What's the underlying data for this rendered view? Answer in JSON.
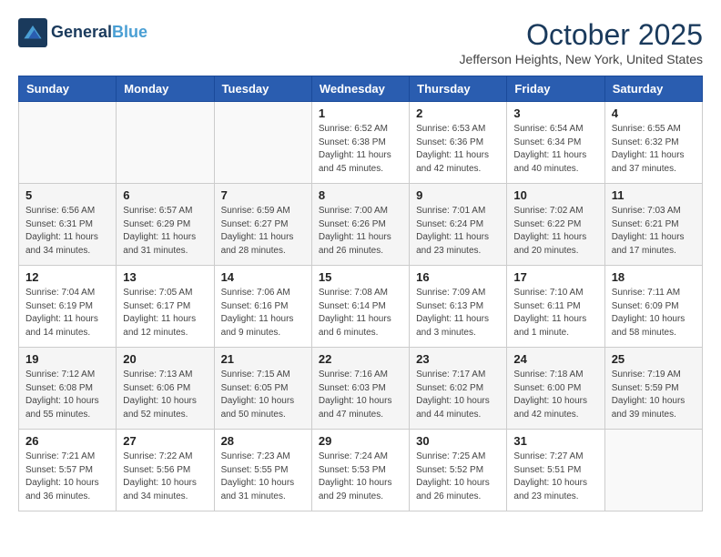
{
  "header": {
    "logo_line1": "General",
    "logo_line2": "Blue",
    "month": "October 2025",
    "location": "Jefferson Heights, New York, United States"
  },
  "weekdays": [
    "Sunday",
    "Monday",
    "Tuesday",
    "Wednesday",
    "Thursday",
    "Friday",
    "Saturday"
  ],
  "weeks": [
    [
      {
        "day": "",
        "info": ""
      },
      {
        "day": "",
        "info": ""
      },
      {
        "day": "",
        "info": ""
      },
      {
        "day": "1",
        "info": "Sunrise: 6:52 AM\nSunset: 6:38 PM\nDaylight: 11 hours\nand 45 minutes."
      },
      {
        "day": "2",
        "info": "Sunrise: 6:53 AM\nSunset: 6:36 PM\nDaylight: 11 hours\nand 42 minutes."
      },
      {
        "day": "3",
        "info": "Sunrise: 6:54 AM\nSunset: 6:34 PM\nDaylight: 11 hours\nand 40 minutes."
      },
      {
        "day": "4",
        "info": "Sunrise: 6:55 AM\nSunset: 6:32 PM\nDaylight: 11 hours\nand 37 minutes."
      }
    ],
    [
      {
        "day": "5",
        "info": "Sunrise: 6:56 AM\nSunset: 6:31 PM\nDaylight: 11 hours\nand 34 minutes."
      },
      {
        "day": "6",
        "info": "Sunrise: 6:57 AM\nSunset: 6:29 PM\nDaylight: 11 hours\nand 31 minutes."
      },
      {
        "day": "7",
        "info": "Sunrise: 6:59 AM\nSunset: 6:27 PM\nDaylight: 11 hours\nand 28 minutes."
      },
      {
        "day": "8",
        "info": "Sunrise: 7:00 AM\nSunset: 6:26 PM\nDaylight: 11 hours\nand 26 minutes."
      },
      {
        "day": "9",
        "info": "Sunrise: 7:01 AM\nSunset: 6:24 PM\nDaylight: 11 hours\nand 23 minutes."
      },
      {
        "day": "10",
        "info": "Sunrise: 7:02 AM\nSunset: 6:22 PM\nDaylight: 11 hours\nand 20 minutes."
      },
      {
        "day": "11",
        "info": "Sunrise: 7:03 AM\nSunset: 6:21 PM\nDaylight: 11 hours\nand 17 minutes."
      }
    ],
    [
      {
        "day": "12",
        "info": "Sunrise: 7:04 AM\nSunset: 6:19 PM\nDaylight: 11 hours\nand 14 minutes."
      },
      {
        "day": "13",
        "info": "Sunrise: 7:05 AM\nSunset: 6:17 PM\nDaylight: 11 hours\nand 12 minutes."
      },
      {
        "day": "14",
        "info": "Sunrise: 7:06 AM\nSunset: 6:16 PM\nDaylight: 11 hours\nand 9 minutes."
      },
      {
        "day": "15",
        "info": "Sunrise: 7:08 AM\nSunset: 6:14 PM\nDaylight: 11 hours\nand 6 minutes."
      },
      {
        "day": "16",
        "info": "Sunrise: 7:09 AM\nSunset: 6:13 PM\nDaylight: 11 hours\nand 3 minutes."
      },
      {
        "day": "17",
        "info": "Sunrise: 7:10 AM\nSunset: 6:11 PM\nDaylight: 11 hours\nand 1 minute."
      },
      {
        "day": "18",
        "info": "Sunrise: 7:11 AM\nSunset: 6:09 PM\nDaylight: 10 hours\nand 58 minutes."
      }
    ],
    [
      {
        "day": "19",
        "info": "Sunrise: 7:12 AM\nSunset: 6:08 PM\nDaylight: 10 hours\nand 55 minutes."
      },
      {
        "day": "20",
        "info": "Sunrise: 7:13 AM\nSunset: 6:06 PM\nDaylight: 10 hours\nand 52 minutes."
      },
      {
        "day": "21",
        "info": "Sunrise: 7:15 AM\nSunset: 6:05 PM\nDaylight: 10 hours\nand 50 minutes."
      },
      {
        "day": "22",
        "info": "Sunrise: 7:16 AM\nSunset: 6:03 PM\nDaylight: 10 hours\nand 47 minutes."
      },
      {
        "day": "23",
        "info": "Sunrise: 7:17 AM\nSunset: 6:02 PM\nDaylight: 10 hours\nand 44 minutes."
      },
      {
        "day": "24",
        "info": "Sunrise: 7:18 AM\nSunset: 6:00 PM\nDaylight: 10 hours\nand 42 minutes."
      },
      {
        "day": "25",
        "info": "Sunrise: 7:19 AM\nSunset: 5:59 PM\nDaylight: 10 hours\nand 39 minutes."
      }
    ],
    [
      {
        "day": "26",
        "info": "Sunrise: 7:21 AM\nSunset: 5:57 PM\nDaylight: 10 hours\nand 36 minutes."
      },
      {
        "day": "27",
        "info": "Sunrise: 7:22 AM\nSunset: 5:56 PM\nDaylight: 10 hours\nand 34 minutes."
      },
      {
        "day": "28",
        "info": "Sunrise: 7:23 AM\nSunset: 5:55 PM\nDaylight: 10 hours\nand 31 minutes."
      },
      {
        "day": "29",
        "info": "Sunrise: 7:24 AM\nSunset: 5:53 PM\nDaylight: 10 hours\nand 29 minutes."
      },
      {
        "day": "30",
        "info": "Sunrise: 7:25 AM\nSunset: 5:52 PM\nDaylight: 10 hours\nand 26 minutes."
      },
      {
        "day": "31",
        "info": "Sunrise: 7:27 AM\nSunset: 5:51 PM\nDaylight: 10 hours\nand 23 minutes."
      },
      {
        "day": "",
        "info": ""
      }
    ]
  ]
}
